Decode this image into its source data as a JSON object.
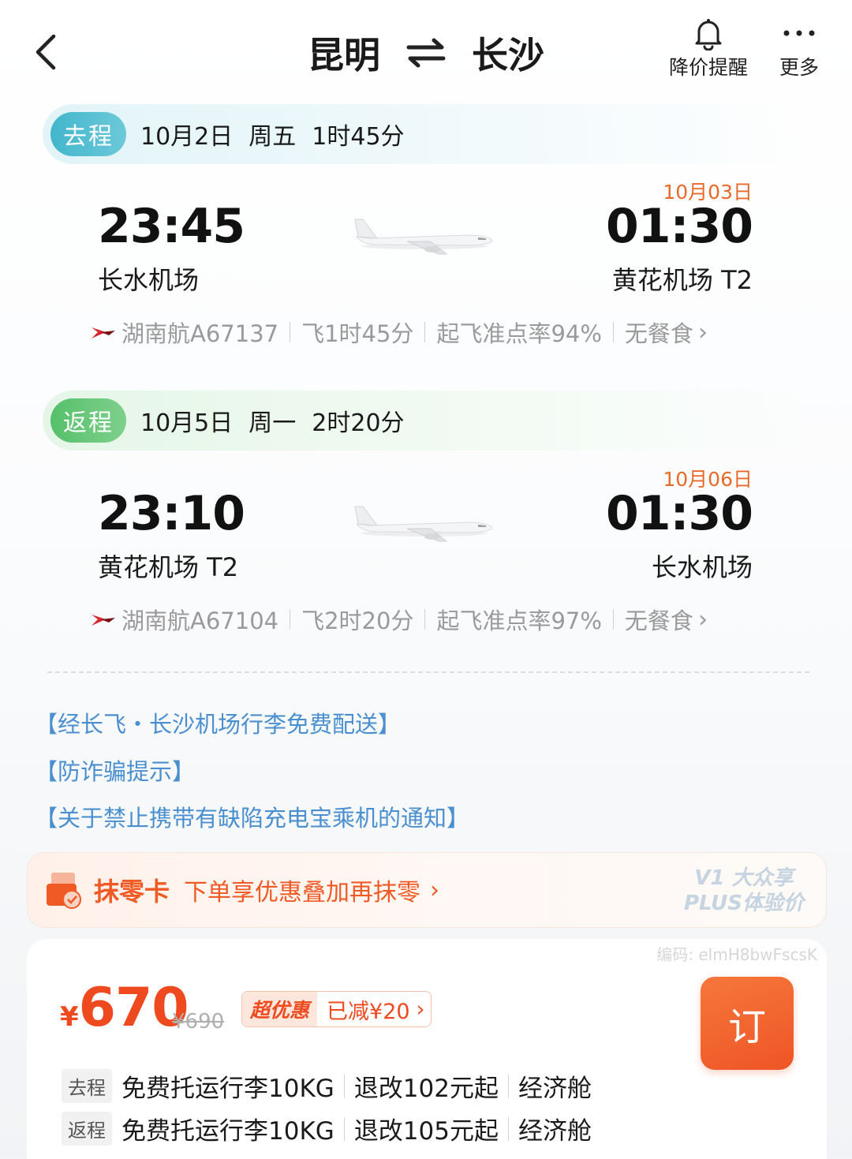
{
  "header": {
    "origin": "昆明",
    "destination": "长沙",
    "price_alert_label": "降价提醒",
    "more_label": "更多"
  },
  "outbound": {
    "tag": "去程",
    "date": "10月2日",
    "weekday": "周五",
    "duration": "1时45分",
    "dep_time": "23:45",
    "dep_airport": "长水机场",
    "arr_date": "10月03日",
    "arr_time": "01:30",
    "arr_airport": "黄花机场 T2",
    "flight": "湖南航A67137",
    "fly_time": "飞1时45分",
    "ontime": "起飞准点率94%",
    "meal": "无餐食"
  },
  "return": {
    "tag": "返程",
    "date": "10月5日",
    "weekday": "周一",
    "duration": "2时20分",
    "dep_time": "23:10",
    "dep_airport": "黄花机场 T2",
    "arr_date": "10月06日",
    "arr_time": "01:30",
    "arr_airport": "长水机场",
    "flight": "湖南航A67104",
    "fly_time": "飞2时20分",
    "ontime": "起飞准点率97%",
    "meal": "无餐食"
  },
  "notices": [
    "【经长飞・长沙机场行李免费配送】",
    "【防诈骗提示】",
    "【关于禁止携带有缺陷充电宝乘机的通知】"
  ],
  "promo": {
    "title": "抹零卡",
    "desc": "下单享优惠叠加再抹零",
    "badge_line1": "V1 大众享",
    "badge_line2": "PLUS体验价"
  },
  "price": {
    "code": "编码: elmH8bwFscsK",
    "currency": "¥",
    "amount": "670",
    "original": "¥690",
    "deal_label": "超优惠",
    "discount": "已减¥20",
    "book_label": "订"
  },
  "fares": [
    {
      "tag": "去程",
      "baggage": "免费托运行李10KG",
      "change": "退改102元起",
      "cabin": "经济舱"
    },
    {
      "tag": "返程",
      "baggage": "免费托运行李10KG",
      "change": "退改105元起",
      "cabin": "经济舱"
    }
  ],
  "colors": {
    "accent": "#ef5a25",
    "outbound_tag": "#43b6cc",
    "return_tag": "#56c06a",
    "notice_link": "#4a8fcf",
    "arrival_date": "#e86a2a"
  }
}
